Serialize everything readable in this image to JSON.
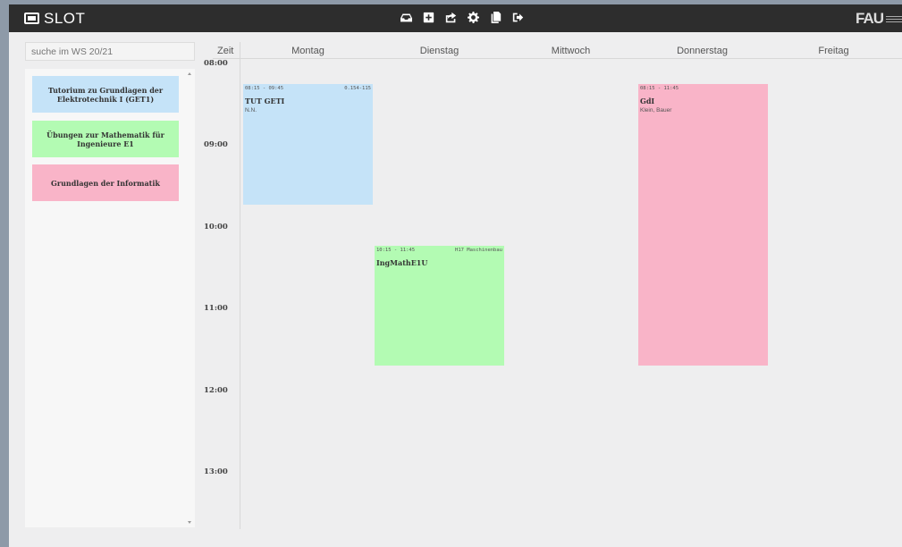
{
  "app": {
    "title": "SLOT",
    "logo_text": "FAU"
  },
  "toolbar": {
    "icons": [
      "inbox-icon",
      "plus-square-icon",
      "share-icon",
      "gear-icon",
      "copy-icon",
      "logout-icon"
    ]
  },
  "search": {
    "placeholder": "suche im WS 20/21"
  },
  "courses": [
    {
      "title": "Tutorium zu Grundlagen der Elektrotechnik I (GET1)",
      "color": "#c5e3f8"
    },
    {
      "title": "Übungen zur Mathematik für Ingenieure E1",
      "color": "#b3fbb3"
    },
    {
      "title": "Grundlagen der Informatik",
      "color": "#f9b4c8"
    }
  ],
  "calendar": {
    "zeit_label": "Zeit",
    "days": [
      "Montag",
      "Dienstag",
      "Mittwoch",
      "Donnerstag",
      "Freitag"
    ],
    "hours": [
      "08:00",
      "09:00",
      "10:00",
      "11:00",
      "12:00",
      "13:00"
    ],
    "events": [
      {
        "day": "Montag",
        "time": "08:15 - 09:45",
        "room": "0.154-115",
        "title": "TUT GETI",
        "lecturer": "N.N.",
        "color": "#c5e3f8"
      },
      {
        "day": "Dienstag",
        "time": "10:15 - 11:45",
        "room": "H17 Maschinenbau",
        "title": "IngMathE1U",
        "lecturer": "",
        "color": "#b3fbb3"
      },
      {
        "day": "Donnerstag",
        "time": "08:15 - 11:45",
        "room": "",
        "title": "GdI",
        "lecturer": "Klein, Bauer",
        "color": "#f9b4c8"
      }
    ]
  }
}
